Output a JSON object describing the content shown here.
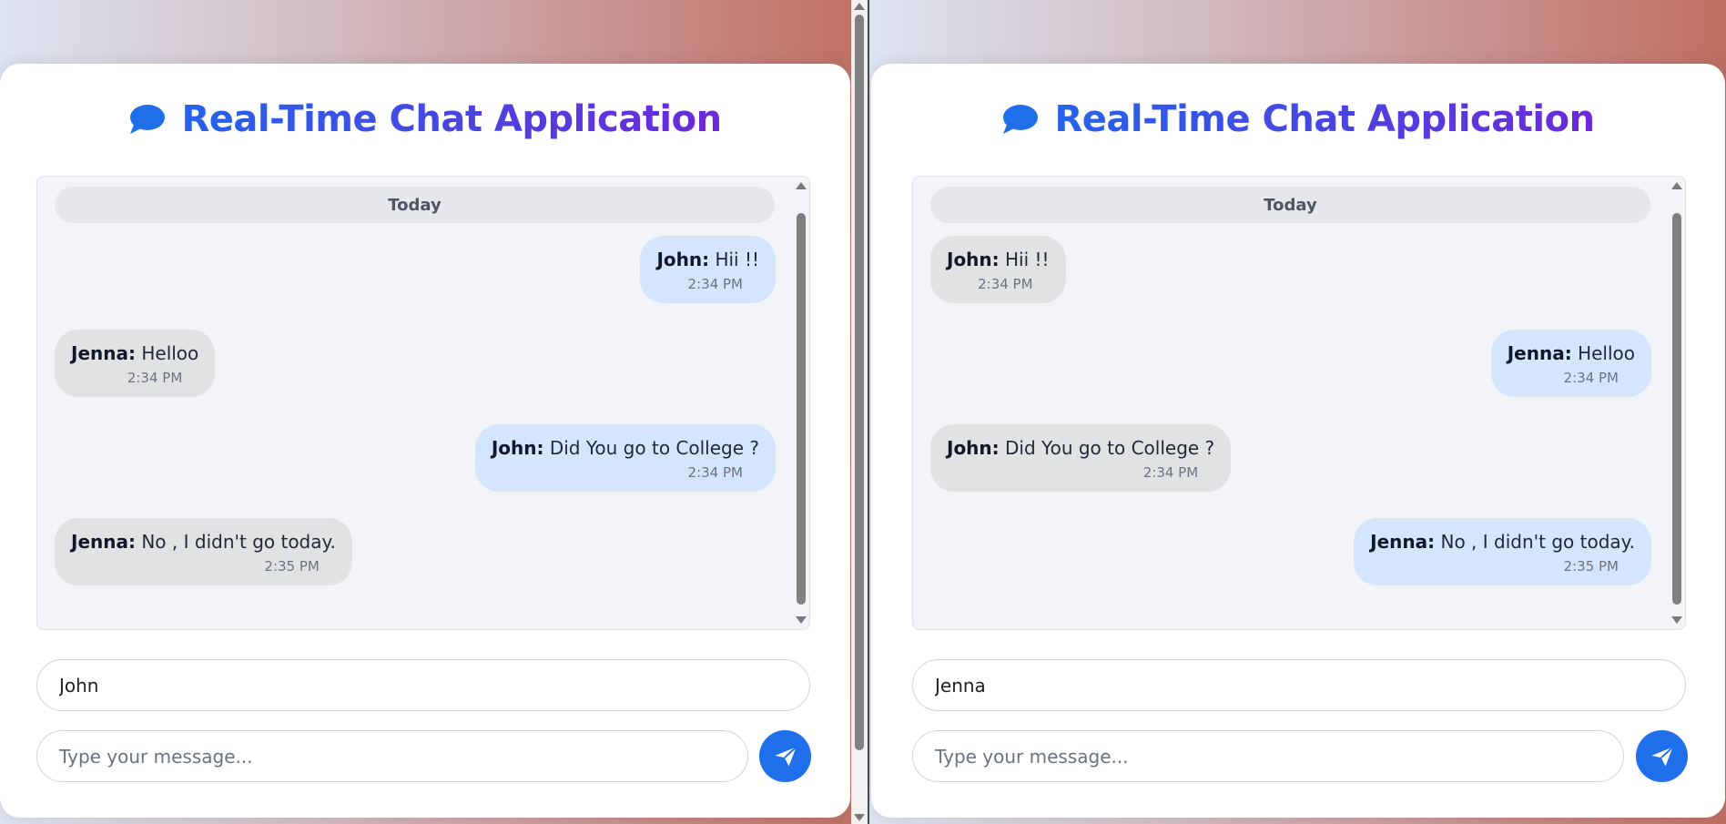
{
  "panes": [
    {
      "title": "Real-Time Chat Application",
      "date_divider": "Today",
      "messages": [
        {
          "sender": "John:",
          "text": "Hii !!",
          "time": "2:34 PM",
          "side": "mine"
        },
        {
          "sender": "Jenna:",
          "text": "Helloo",
          "time": "2:34 PM",
          "side": "theirs"
        },
        {
          "sender": "John:",
          "text": "Did You go to College ?",
          "time": "2:34 PM",
          "side": "mine"
        },
        {
          "sender": "Jenna:",
          "text": "No , I didn't go today.",
          "time": "2:35 PM",
          "side": "theirs"
        }
      ],
      "name_value": "John",
      "message_placeholder": "Type your message...",
      "send_icon": "send-paper-plane-icon",
      "chat_icon": "chat-bubble-icon"
    },
    {
      "title": "Real-Time Chat Application",
      "date_divider": "Today",
      "messages": [
        {
          "sender": "John:",
          "text": "Hii !!",
          "time": "2:34 PM",
          "side": "theirs"
        },
        {
          "sender": "Jenna:",
          "text": "Helloo",
          "time": "2:34 PM",
          "side": "mine"
        },
        {
          "sender": "John:",
          "text": "Did You go to College ?",
          "time": "2:34 PM",
          "side": "theirs"
        },
        {
          "sender": "Jenna:",
          "text": "No , I didn't go today.",
          "time": "2:35 PM",
          "side": "mine"
        }
      ],
      "name_value": "Jenna",
      "message_placeholder": "Type your message...",
      "send_icon": "send-paper-plane-icon",
      "chat_icon": "chat-bubble-icon"
    }
  ],
  "colors": {
    "accent": "#1f6feb",
    "title_gradient_start": "#2563eb",
    "title_gradient_end": "#6d28d9",
    "own_bubble": "#d3e6fd",
    "other_bubble": "#e1e2e4"
  }
}
